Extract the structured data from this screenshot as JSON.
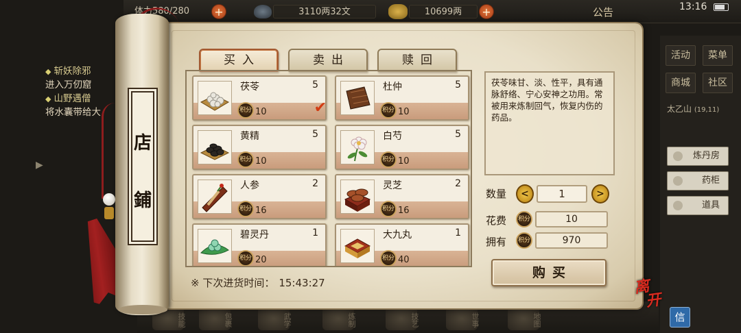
{
  "status_bar": {
    "time": "13:16"
  },
  "top_bar": {
    "stamina": "体力580/280",
    "silver": "3110两32文",
    "gold": "10699两",
    "announcement": "公告"
  },
  "quests": [
    {
      "title": "斩妖除邪",
      "desc": "进入万仞窟"
    },
    {
      "title": "山野遇僧",
      "desc": "将水囊带给大"
    }
  ],
  "right_menu": {
    "buttons": [
      "活动",
      "菜单",
      "商城",
      "社区"
    ],
    "location": "太乙山",
    "coords": "(19,11)",
    "side_buttons": [
      "炼丹房",
      "药柜",
      "道具"
    ]
  },
  "bottom_menu": [
    "技能",
    "包裹",
    "武学",
    "炼制",
    "技艺",
    "世事",
    "地图"
  ],
  "chat_button": "信",
  "shop": {
    "title": [
      "店",
      "鋪"
    ],
    "tabs": [
      "买入",
      "卖出",
      "赎回"
    ],
    "currency_icon_text": "积分",
    "items": [
      {
        "name": "茯苓",
        "qty": "5",
        "price": "10",
        "selected": true
      },
      {
        "name": "杜仲",
        "qty": "5",
        "price": "10",
        "selected": false
      },
      {
        "name": "黄精",
        "qty": "5",
        "price": "10",
        "selected": false
      },
      {
        "name": "白芍",
        "qty": "5",
        "price": "10",
        "selected": false
      },
      {
        "name": "人参",
        "qty": "2",
        "price": "16",
        "selected": false
      },
      {
        "name": "灵芝",
        "qty": "2",
        "price": "16",
        "selected": false
      },
      {
        "name": "碧灵丹",
        "qty": "1",
        "price": "20",
        "selected": false
      },
      {
        "name": "大九丸",
        "qty": "1",
        "price": "40",
        "selected": false
      }
    ],
    "restock_label": "※ 下次进货时间：",
    "restock_time": "15:43:27",
    "description": "茯苓味甘、淡、性平，具有通脉舒络、宁心安神之功用。常被用来炼制回气，恢复内伤的药品。",
    "quantity_label": "数量",
    "quantity_value": "1",
    "cost_label": "花费",
    "cost_value": "10",
    "owned_label": "拥有",
    "owned_value": "970",
    "buy_label": "购买",
    "leave_label": [
      "离",
      "开"
    ]
  },
  "colors": {
    "accent": "#d23b12",
    "parchment": "#ece3cd",
    "price_band": "#cfa484"
  }
}
